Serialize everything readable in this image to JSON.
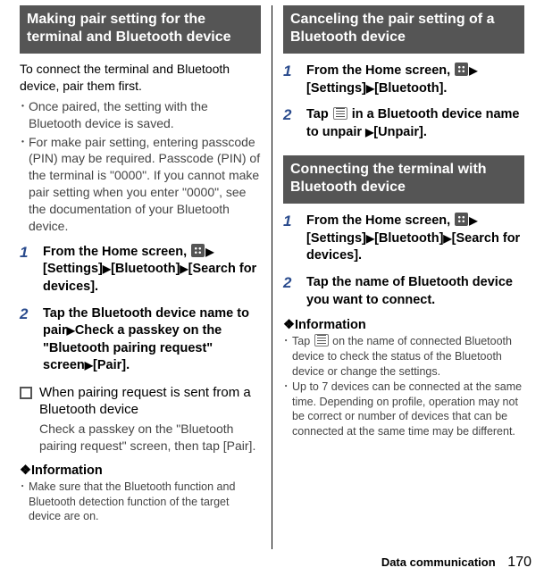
{
  "footer": {
    "section": "Data communication",
    "page": "170"
  },
  "left": {
    "header": "Making pair setting for the terminal and Bluetooth device",
    "intro": "To connect the terminal and Bluetooth device, pair them first.",
    "bullets": [
      "Once paired, the setting with the Bluetooth device is saved.",
      "For make pair setting, entering passcode (PIN) may be required. Passcode (PIN) of the terminal is \"0000\". If you cannot make pair setting when you enter \"0000\", see the documentation of your Bluetooth device."
    ],
    "steps": {
      "s1_a": "From the Home screen, ",
      "s1_b": "[Settings]",
      "s1_c": "[Bluetooth]",
      "s1_d": "[Search for devices].",
      "s2_a": "Tap the Bluetooth device name to pair",
      "s2_b": "Check a passkey on the \"Bluetooth pairing request\" screen",
      "s2_c": "[Pair]."
    },
    "sub_title": "When pairing request is sent from a Bluetooth device",
    "sub_desc": "Check a passkey on the \"Bluetooth pairing request\" screen, then tap [Pair].",
    "info_head": "❖Information",
    "info_bullets": [
      "Make sure that the Bluetooth function and Bluetooth detection function of the target device are on."
    ]
  },
  "right": {
    "cancel": {
      "header": "Canceling the pair setting of a Bluetooth device",
      "s1_a": "From the Home screen, ",
      "s1_b": "[Settings]",
      "s1_c": "[Bluetooth].",
      "s2_a": "Tap ",
      "s2_b": " in a Bluetooth device name to unpair ",
      "s2_c": "[Unpair]."
    },
    "connect": {
      "header": "Connecting the terminal with Bluetooth device",
      "s1_a": "From the Home screen, ",
      "s1_b": "[Settings]",
      "s1_c": "[Bluetooth]",
      "s1_d": "[Search for devices].",
      "s2": "Tap the name of Bluetooth device you want to connect."
    },
    "info_head": "❖Information",
    "info_bullets": [
      {
        "a": "Tap ",
        "b": " on the name of connected Bluetooth device to check the status of the Bluetooth device or change the settings."
      },
      {
        "a": "Up to 7 devices can be connected at the same time. Depending on profile, operation may not be correct or number of devices that can be connected at the same time may be different."
      }
    ]
  }
}
